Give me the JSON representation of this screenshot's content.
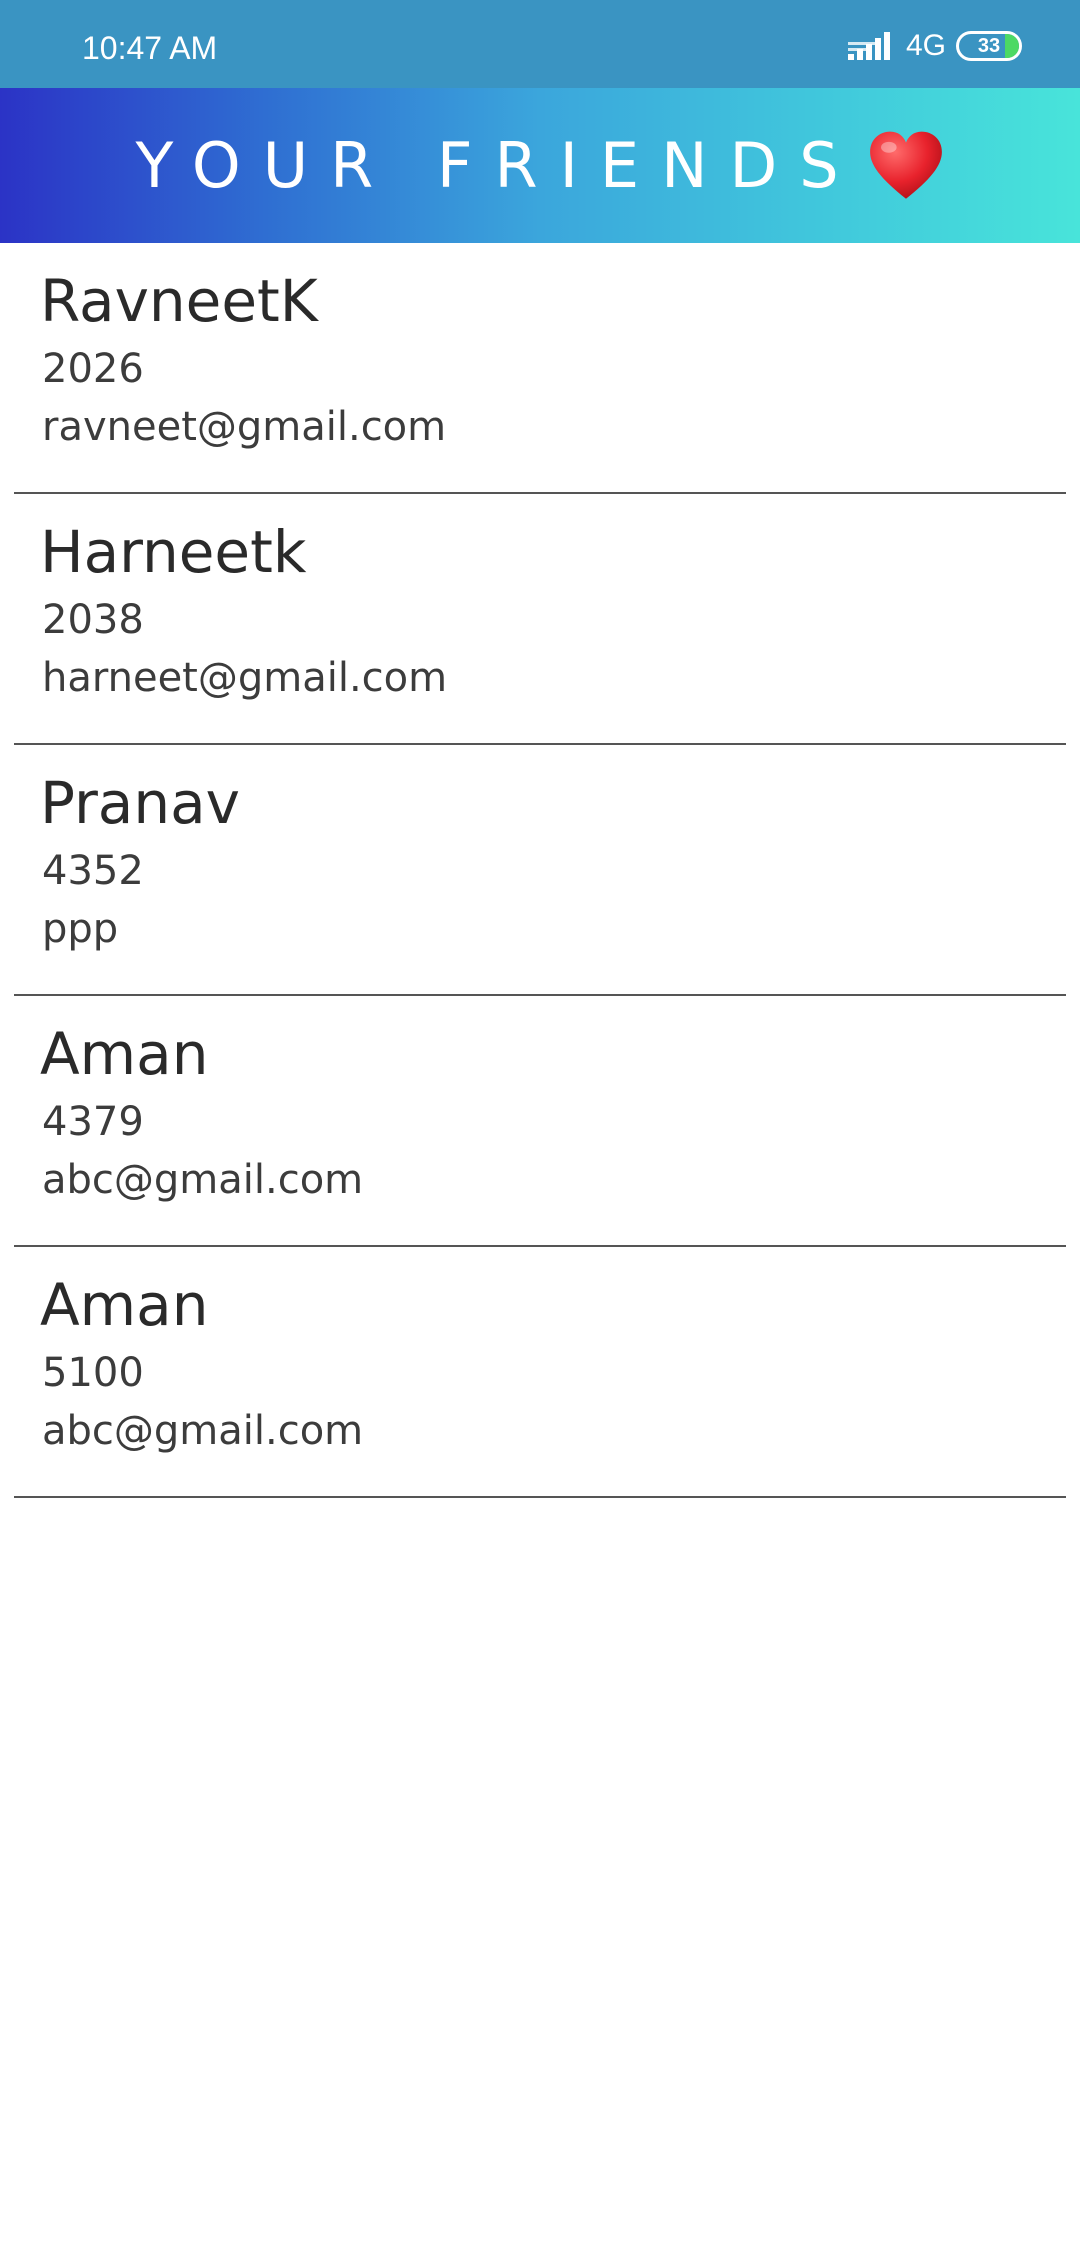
{
  "status_bar": {
    "time": "10:47 AM",
    "network": "4G",
    "battery": "33",
    "battery_color": "#4cd964"
  },
  "header": {
    "title": "YOUR FRIENDS",
    "icon": "heart-icon",
    "gradient_start": "#2b33c6",
    "gradient_end": "#48e4da"
  },
  "friends": [
    {
      "name": "RavneetK",
      "id": "2026",
      "email": "ravneet@gmail.com"
    },
    {
      "name": "Harneetk",
      "id": "2038",
      "email": "harneet@gmail.com"
    },
    {
      "name": "Pranav",
      "id": "4352",
      "email": "ppp"
    },
    {
      "name": "Aman",
      "id": "4379",
      "email": "abc@gmail.com"
    },
    {
      "name": "Aman",
      "id": "5100",
      "email": "abc@gmail.com"
    }
  ]
}
